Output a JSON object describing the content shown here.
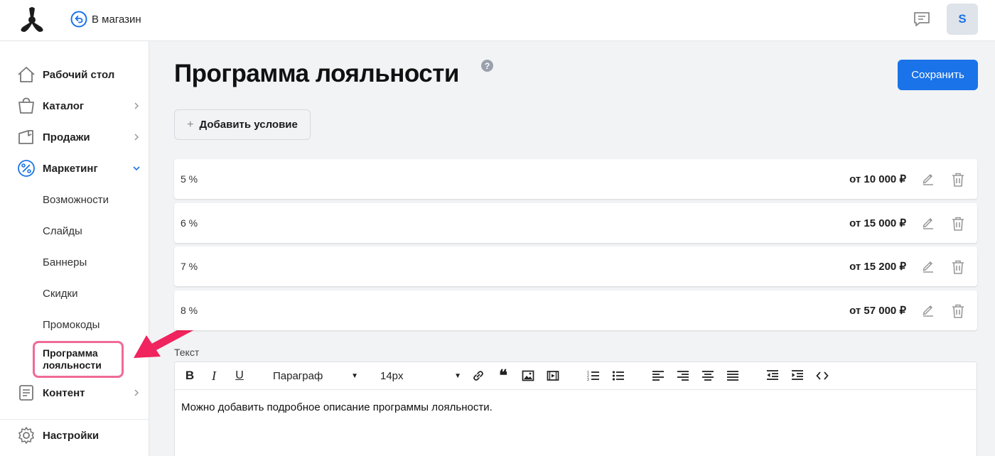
{
  "topbar": {
    "store_link": "В магазин",
    "avatar_letter": "S"
  },
  "sidebar": {
    "items": [
      {
        "label": "Рабочий стол",
        "icon": "home-icon"
      },
      {
        "label": "Каталог",
        "icon": "shopping-bag-icon"
      },
      {
        "label": "Продажи",
        "icon": "sales-icon"
      },
      {
        "label": "Маркетинг",
        "icon": "percent-icon"
      },
      {
        "label": "Контент",
        "icon": "document-icon"
      },
      {
        "label": "Настройки",
        "icon": "gear-icon"
      }
    ],
    "marketing_sub": [
      "Возможности",
      "Слайды",
      "Баннеры",
      "Скидки",
      "Промокоды"
    ],
    "active_sub": "Программа лояльности"
  },
  "main": {
    "title": "Программа лояльности",
    "save_label": "Сохранить",
    "add_condition_label": "Добавить условие",
    "conditions": [
      {
        "percent": "5 %",
        "amount": "от 10 000 ₽"
      },
      {
        "percent": "6 %",
        "amount": "от 15 000 ₽"
      },
      {
        "percent": "7 %",
        "amount": "от 15 200 ₽"
      },
      {
        "percent": "8 %",
        "amount": "от 57 000 ₽"
      }
    ],
    "text_label": "Текст",
    "editor": {
      "paragraph_select": "Параграф",
      "font_size_select": "14px",
      "content": "Можно добавить подробное описание программы лояльности."
    }
  },
  "colors": {
    "accent": "#1a73e8",
    "highlight": "#f06a95",
    "arrow": "#f0245e"
  }
}
